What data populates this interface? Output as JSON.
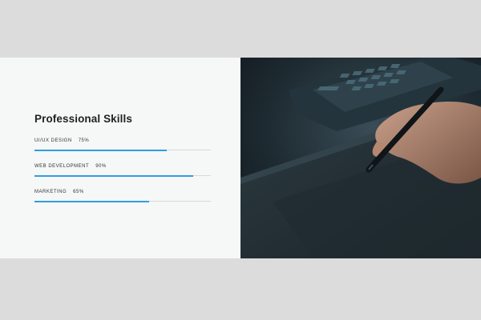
{
  "skills_section": {
    "title": "Professional Skills",
    "skills": [
      {
        "name": "UI/UX DESIGN",
        "percent_label": "75%",
        "level": 0.75
      },
      {
        "name": "WEB DEVELOPMENT",
        "percent_label": "90%",
        "level": 0.9
      },
      {
        "name": "MARKETING",
        "percent_label": "65%",
        "level": 0.65
      }
    ],
    "accent_color": "#2f9de3"
  },
  "photo": {
    "subject": "hand-drawing-on-graphics-tablet"
  }
}
